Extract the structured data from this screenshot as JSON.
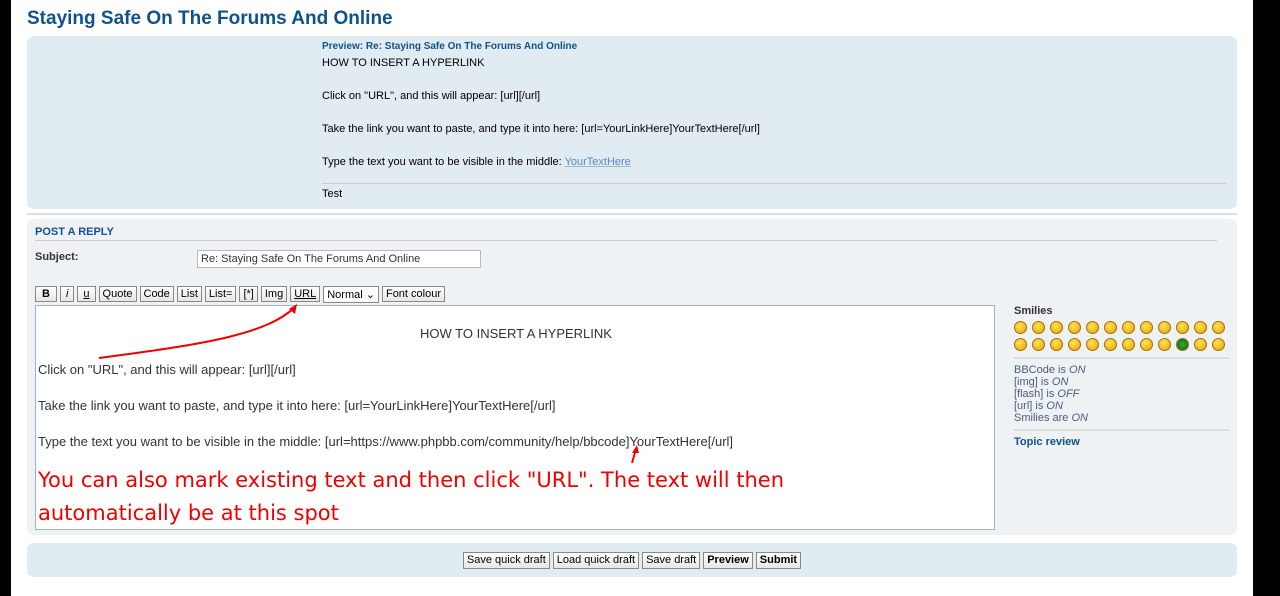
{
  "title": "Staying Safe On The Forums And Online",
  "preview": {
    "heading": "Preview: Re: Staying Safe On The Forums And Online",
    "lines": [
      "HOW TO INSERT A HYPERLINK",
      "Click on \"URL\", and this will appear: [url][/url]",
      "Take the link you want to paste, and type it into here: [url=YourLinkHere]YourTextHere[/url]",
      "Type the text you want to be visible in the middle: "
    ],
    "link": "YourTextHere",
    "signature": "Test"
  },
  "reply": {
    "heading": "POST A REPLY",
    "subject_label": "Subject:",
    "subject_value": "Re: Staying Safe On The Forums And Online",
    "toolbar": [
      "B",
      "i",
      "u",
      "Quote",
      "Code",
      "List",
      "List=",
      "[*]",
      "Img",
      "URL"
    ],
    "font_size": "Normal",
    "font_colour": "Font colour",
    "body": [
      "HOW TO INSERT A HYPERLINK",
      "Click on \"URL\", and this will appear: [url][/url]",
      "Take the link you want to paste, and type it into here: [url=YourLinkHere]YourTextHere[/url]",
      "Type the text you want to be visible in the middle: [url=https://www.phpbb.com/community/help/bbcode]YourTextHere[/url]"
    ],
    "annotation": [
      "You can also mark existing text and then click \"URL\". The text will then",
      "automatically be at this spot"
    ],
    "annotation_color": "#e00000"
  },
  "sidebar": {
    "smilies_label": "Smilies",
    "smilies_count": 24,
    "status": [
      {
        "label": "BBCode is ",
        "value": "ON"
      },
      {
        "label": "[img] is ",
        "value": "ON"
      },
      {
        "label": "[flash] is ",
        "value": "OFF"
      },
      {
        "label": "[url] is ",
        "value": "ON"
      },
      {
        "label": "Smilies are ",
        "value": "ON"
      }
    ],
    "topic_review": "Topic review"
  },
  "actions": [
    "Save quick draft",
    "Load quick draft",
    "Save draft",
    "Preview",
    "Submit"
  ]
}
